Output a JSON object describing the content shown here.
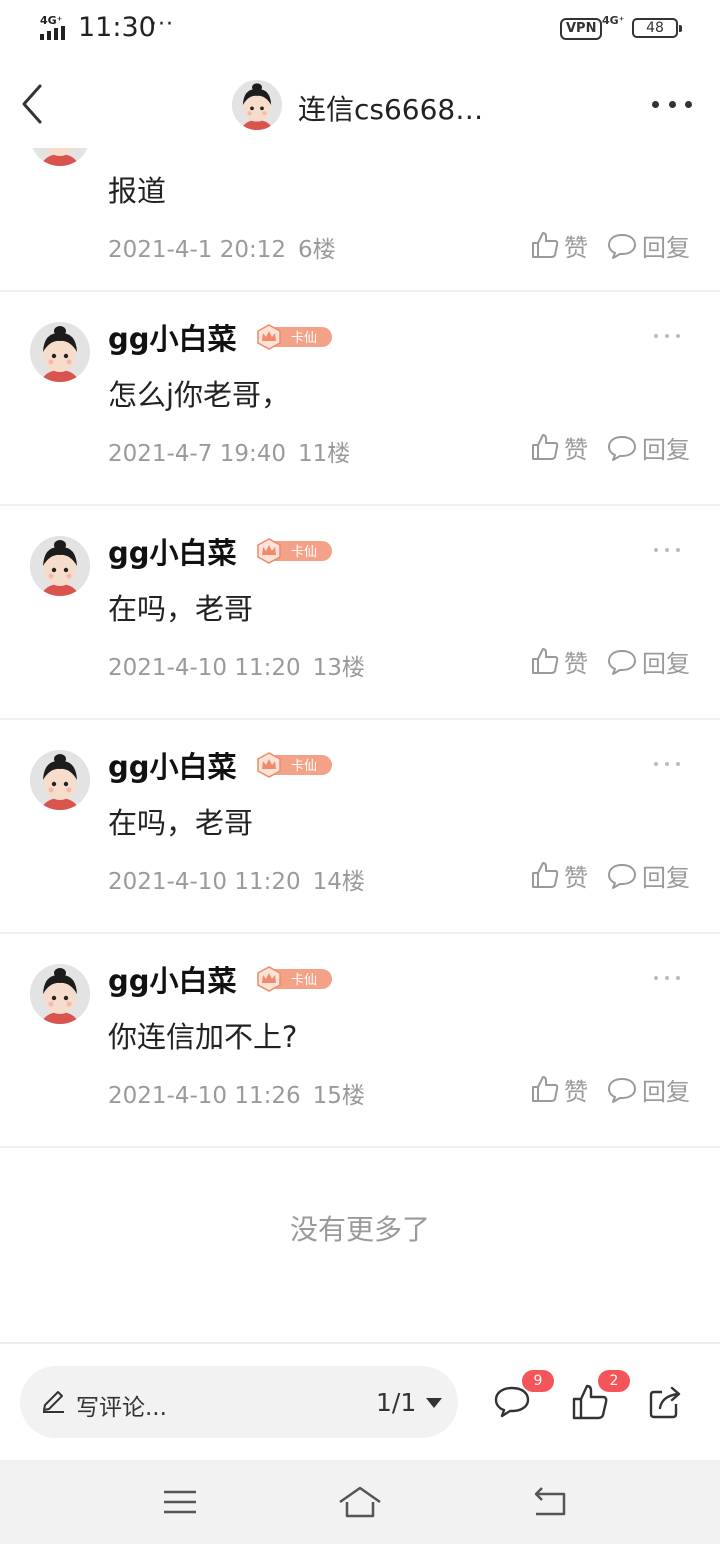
{
  "status_bar": {
    "network_left": "4G⁺",
    "time": "11:30",
    "notif_dots": "···",
    "vpn": "VPN",
    "network_right": "4G⁺",
    "battery": "48"
  },
  "header": {
    "title": "连信cs6668…",
    "icons": [
      "back-chevron-icon",
      "avatar",
      "more-dots-icon"
    ]
  },
  "partial_comment": {
    "text": "报道",
    "date": "2021-4-1 20:12",
    "floor": "6楼",
    "like_label": "赞",
    "reply_label": "回复"
  },
  "comments": [
    {
      "name": "gg小白菜",
      "badge": "卡仙",
      "text": "怎么j你老哥，",
      "date": "2021-4-7 19:40",
      "floor": "11楼",
      "like_label": "赞",
      "reply_label": "回复"
    },
    {
      "name": "gg小白菜",
      "badge": "卡仙",
      "text": "在吗，老哥",
      "date": "2021-4-10 11:20",
      "floor": "13楼",
      "like_label": "赞",
      "reply_label": "回复"
    },
    {
      "name": "gg小白菜",
      "badge": "卡仙",
      "text": "在吗，老哥",
      "date": "2021-4-10 11:20",
      "floor": "14楼",
      "like_label": "赞",
      "reply_label": "回复"
    },
    {
      "name": "gg小白菜",
      "badge": "卡仙",
      "text": "你连信加不上?",
      "date": "2021-4-10 11:26",
      "floor": "15楼",
      "like_label": "赞",
      "reply_label": "回复"
    }
  ],
  "end_text": "没有更多了",
  "bottom_bar": {
    "placeholder": "写评论...",
    "page_indicator": "1/1",
    "comment_count": "9",
    "like_count": "2",
    "icons": [
      "pen-icon",
      "comment-bubble-icon",
      "thumb-up-icon",
      "share-icon"
    ]
  },
  "system_nav": {
    "icons": [
      "menu-icon",
      "home-icon",
      "back-icon"
    ]
  },
  "colors": {
    "badge_accent": "#f08a6a",
    "count_badge": "#f4545a",
    "meta_gray": "#9a9a9a",
    "divider": "#f0f0f0"
  }
}
